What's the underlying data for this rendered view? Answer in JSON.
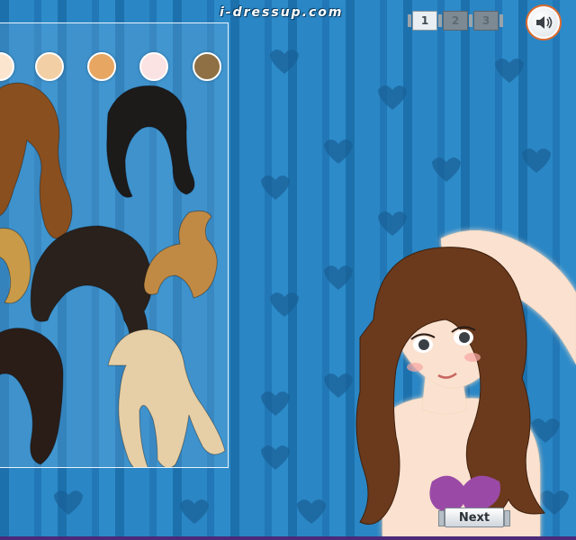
{
  "site": {
    "logo_text": "i-dressup.com"
  },
  "pages": [
    {
      "label": "1",
      "active": true
    },
    {
      "label": "2",
      "active": false
    },
    {
      "label": "3",
      "active": false
    }
  ],
  "sound": {
    "icon": "speaker-icon"
  },
  "hair_colors": [
    "#fbe5cf",
    "#f2cfa4",
    "#e7a662",
    "#fce3e3",
    "#8e7044"
  ],
  "hairstyles": [
    {
      "name": "long-wavy-brown",
      "color": "#8a4f1e"
    },
    {
      "name": "medium-black",
      "color": "#1d1a1a"
    },
    {
      "name": "short-blonde-partial",
      "color": "#c99a48"
    },
    {
      "name": "curly-black",
      "color": "#2a211c"
    },
    {
      "name": "updo-light-brown",
      "color": "#c08a45"
    },
    {
      "name": "long-curly-dark",
      "color": "#2a1d17"
    },
    {
      "name": "long-wavy-platinum",
      "color": "#e6cfa6"
    }
  ],
  "model": {
    "hair_color": "#6b3a1d",
    "skin": "#fbe1cf",
    "bikini": "#9a4aa6"
  },
  "buttons": {
    "next_label": "Next"
  }
}
